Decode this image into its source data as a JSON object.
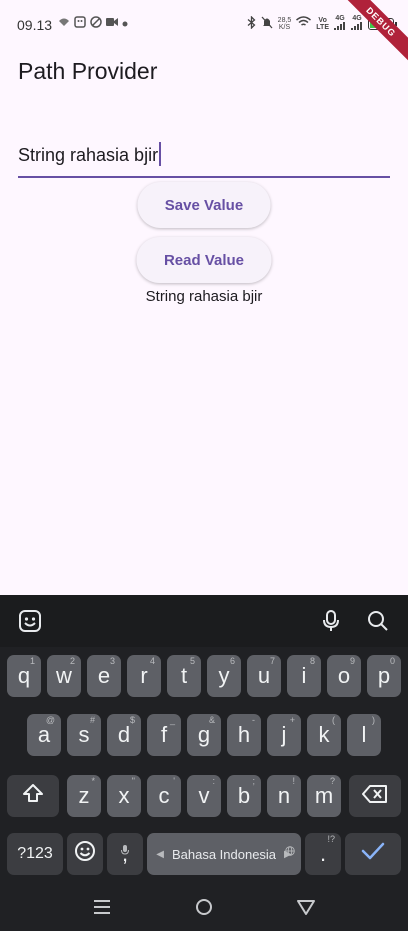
{
  "status_bar": {
    "time": "09.13",
    "net_speed_value": "28,5",
    "net_speed_unit": "K/S",
    "volte_top": "Vo",
    "volte_bottom": "LTE",
    "net1": "4G",
    "net2": "4G"
  },
  "debug_banner": "DEBUG",
  "app": {
    "title": "Path Provider",
    "input_value": "String rahasia bjir",
    "save_button": "Save Value",
    "read_button": "Read Value",
    "result_text": "String rahasia bjir"
  },
  "keyboard": {
    "row1": [
      "q",
      "w",
      "e",
      "r",
      "t",
      "y",
      "u",
      "i",
      "o",
      "p"
    ],
    "row1_hints": [
      "1",
      "2",
      "3",
      "4",
      "5",
      "6",
      "7",
      "8",
      "9",
      "0"
    ],
    "row2": [
      "a",
      "s",
      "d",
      "f",
      "g",
      "h",
      "j",
      "k",
      "l"
    ],
    "row2_hints": [
      "@",
      "#",
      "$",
      "_",
      "&",
      "-",
      "+",
      "(",
      ")"
    ],
    "row3": [
      "z",
      "x",
      "c",
      "v",
      "b",
      "n",
      "m"
    ],
    "row3_hints": [
      "*",
      "\"",
      "'",
      ":",
      ";",
      "!",
      "?"
    ],
    "symbols_key": "?123",
    "comma_key": ",",
    "space_label": "Bahasa Indonesia",
    "period_key": ".",
    "period_hint": "!?"
  },
  "icons": {
    "emoji": "sticker-icon",
    "mic": "mic-icon",
    "search": "search-icon",
    "shift": "shift-icon",
    "backspace": "backspace-icon",
    "enter": "check-icon"
  },
  "colors": {
    "accent": "#6750a4",
    "background": "#fef7ff",
    "keyboard_bg": "#202124",
    "key_bg": "#5e6066",
    "key_fn_bg": "#3c3d41",
    "enter": "#8ab4f8"
  }
}
